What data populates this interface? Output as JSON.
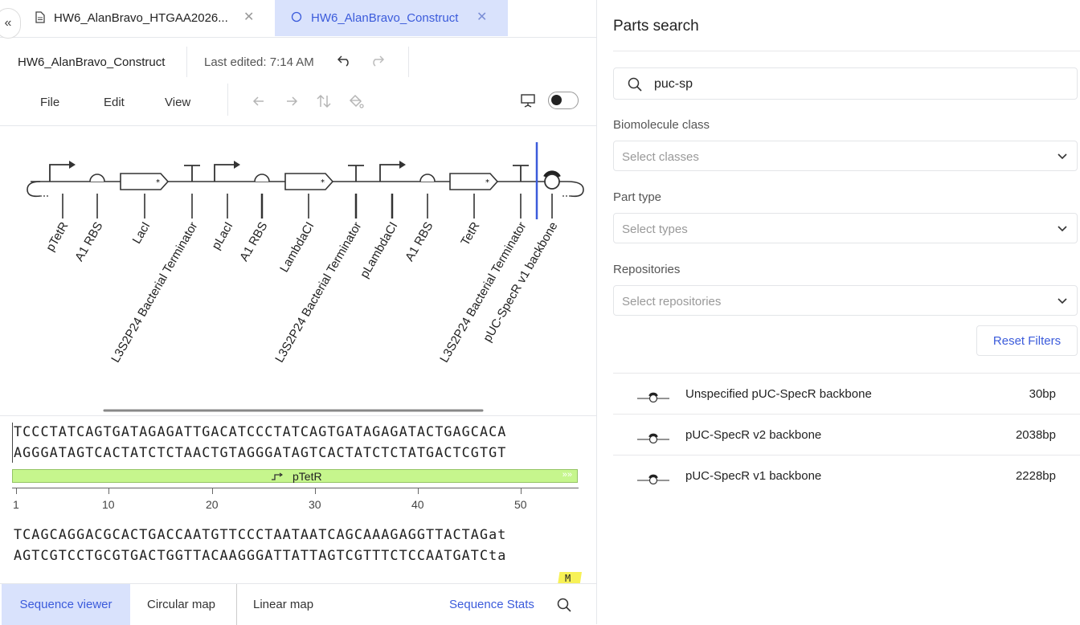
{
  "tabs": [
    {
      "label": "HW6_AlanBravo_HTGAA2026...",
      "icon": "document-icon"
    },
    {
      "label": "HW6_AlanBravo_Construct",
      "icon": "circle-icon"
    }
  ],
  "header": {
    "title": "HW6_AlanBravo_Construct",
    "last_edited": "Last edited: 7:14 AM"
  },
  "menu": {
    "file": "File",
    "edit": "Edit",
    "view": "View"
  },
  "map": {
    "part_labels": [
      "pTetR",
      "A1 RBS",
      "LacI",
      "L3S2P24 Bacterial Terminator",
      "pLacI",
      "A1 RBS",
      "LambdaCI",
      "L3S2P24 Bacterial Terminator",
      "pLambdaCI",
      "A1 RBS",
      "TetR",
      "L3S2P24 Bacterial Terminator",
      "pUC-SpecR v1 backbone"
    ]
  },
  "sequence": {
    "block1_top": "TCCCTATCAGTGATAGAGATTGACATCCCTATCAGTGATAGAGATACTGAGCACA",
    "block1_bottom": "AGGGATAGTCACTATCTCTAACTGTAGGGATAGTCACTATCTCTATGACTCGTGT",
    "annotation": "pTetR",
    "ruler": [
      "1",
      "10",
      "20",
      "30",
      "40",
      "50"
    ],
    "block2_top": "TCAGCAGGACGCACTGACCAATGTTCCCTAATAATCAGCAAAGAGGTTACTAGat",
    "block2_bottom": "AGTCGTCCTGCGTGACTGGTTACAAGGGATTATTAGTCGTTTCTCCAATGATCta",
    "marker": "M"
  },
  "bottom": {
    "seq_viewer": "Sequence viewer",
    "circular": "Circular map",
    "linear": "Linear map",
    "stats": "Sequence Stats"
  },
  "right": {
    "title": "Parts search",
    "search_value": "puc-sp",
    "biomolecule_label": "Biomolecule class",
    "biomolecule_ph": "Select classes",
    "parttype_label": "Part type",
    "parttype_ph": "Select types",
    "repos_label": "Repositories",
    "repos_ph": "Select repositories",
    "reset": "Reset Filters",
    "results": [
      {
        "name": "Unspecified pUC-SpecR backbone",
        "bp": "30bp"
      },
      {
        "name": "pUC-SpecR v2 backbone",
        "bp": "2038bp"
      },
      {
        "name": "pUC-SpecR v1 backbone",
        "bp": "2228bp"
      }
    ]
  },
  "colors": {
    "accent": "#3b5bdb",
    "active_tab_bg": "#d9e2fc",
    "annotation_fill": "#c6f68d",
    "marker_fill": "#f7f156"
  }
}
